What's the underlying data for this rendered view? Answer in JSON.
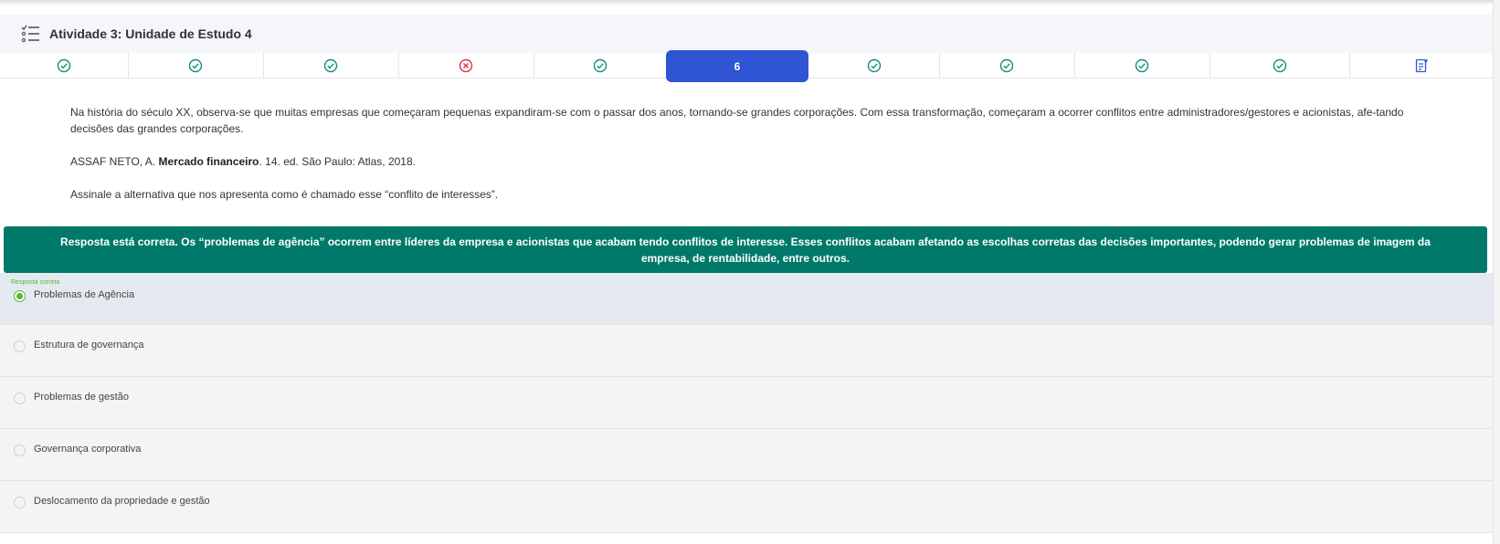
{
  "header": {
    "title": "Atividade 3: Unidade de Estudo 4",
    "icon": "list-check-icon"
  },
  "nav": {
    "items": [
      {
        "status": "correct",
        "icon": "check-circle-icon"
      },
      {
        "status": "correct",
        "icon": "check-circle-icon"
      },
      {
        "status": "correct",
        "icon": "check-circle-icon"
      },
      {
        "status": "wrong",
        "icon": "x-circle-icon"
      },
      {
        "status": "correct",
        "icon": "check-circle-icon"
      },
      {
        "status": "current",
        "label": "6"
      },
      {
        "status": "correct",
        "icon": "check-circle-icon"
      },
      {
        "status": "correct",
        "icon": "check-circle-icon"
      },
      {
        "status": "correct",
        "icon": "check-circle-icon"
      },
      {
        "status": "correct",
        "icon": "check-circle-icon"
      },
      {
        "status": "summary",
        "icon": "document-edit-icon"
      }
    ],
    "active_label": "6",
    "colors": {
      "correct": "#138f7a",
      "wrong": "#e0314b",
      "active": "#2f55d4"
    }
  },
  "question": {
    "paragraph": "Na história do século XX, observa-se que muitas empresas que começaram pequenas expandiram-se com o passar dos anos, tornando-se grandes corporações. Com essa transformação, começaram a ocorrer conflitos entre administradores/gestores e acionistas, afe-tando decisões das grandes corporações.",
    "reference_prefix": "ASSAF NETO, A. ",
    "reference_title": "Mercado financeiro",
    "reference_suffix": ". 14. ed. São Paulo: Atlas, 2018.",
    "prompt": "Assinale a alternativa que nos apresenta como é chamado esse “conflito de interesses”."
  },
  "feedback": {
    "text": "Resposta está correta. Os “problemas de agência” ocorrem entre líderes da empresa e acionistas que acabam tendo conflitos de interesse. Esses conflitos acabam afetando as escolhas corretas das decisões importantes, podendo gerar problemas de imagem da empresa, de rentabilidade, entre outros.",
    "color": "#00796b"
  },
  "options": {
    "correct_tag": "Resposta correta",
    "items": [
      {
        "label": "Problemas de Agência",
        "selected": true
      },
      {
        "label": "Estrutura de governança",
        "selected": false
      },
      {
        "label": "Problemas de gestão",
        "selected": false
      },
      {
        "label": "Governança corporativa",
        "selected": false
      },
      {
        "label": "Deslocamento da propriedade e gestão",
        "selected": false
      }
    ]
  }
}
